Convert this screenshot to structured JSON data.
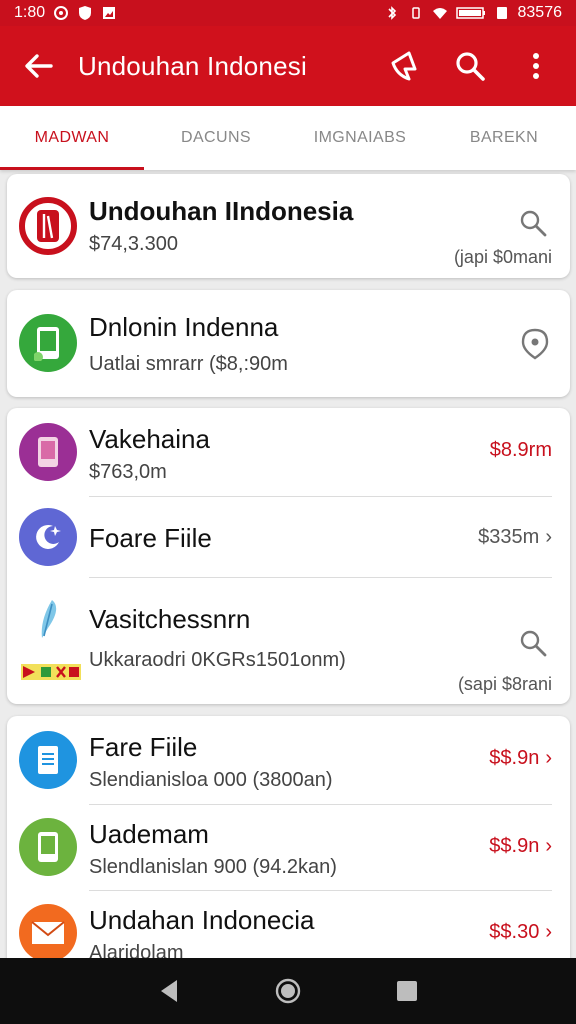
{
  "status_bar": {
    "time": "1:80",
    "battery_text": "83576",
    "color": "#c8101d"
  },
  "app_bar": {
    "title": "Undouhan Indonesi",
    "back_icon": "arrow-left-icon",
    "actions": [
      "pin-icon",
      "search-icon",
      "more-vert-icon"
    ],
    "color": "#d0111c"
  },
  "tabs": [
    {
      "label": "MADWAN",
      "active": true
    },
    {
      "label": "DACUNS",
      "active": false
    },
    {
      "label": "IMGNAIABS",
      "active": false
    },
    {
      "label": "BAREKN",
      "active": false
    }
  ],
  "cards": {
    "c1": {
      "title": "Undouhan IIndonesia",
      "subtitle": "$74,3.300",
      "right_text": "(japi $0mani",
      "icon": "red-app-icon",
      "action_icon": "search-icon"
    },
    "c2": {
      "title": "Dnlonin Indenna",
      "subtitle": "Uatlai smrarr ($8,:90m",
      "icon": "green-phone-app-icon",
      "action_icon": "location-pin-icon"
    },
    "c3": [
      {
        "title": "Vakehaina",
        "subtitle": "$763,0m",
        "right_text": "$8.9rm",
        "icon": "purple-phone-app-icon"
      },
      {
        "title": "Foare Fiile",
        "right_text": "$335m",
        "icon": "blue-moon-app-icon"
      },
      {
        "title": "Vasitchessnrn",
        "subtitle": "Ukkaraodri 0KGRs1501onm)",
        "right_text": "(sapi $8rani",
        "icon": "feather-app-icon",
        "action_icon": "search-icon"
      }
    ],
    "c4": [
      {
        "title": "Fare Fiile",
        "subtitle": "Slendianisloa 000 (3800an)",
        "right_text": "$$.9n",
        "icon": "blue-document-app-icon"
      },
      {
        "title": "Uademam",
        "subtitle": "Slendlanislan 900 (94.2kan)",
        "right_text": "$$.9n",
        "icon": "green-phone-app-icon"
      },
      {
        "title": "Undahan Indonecia",
        "subtitle": "Alaridolam",
        "right_text": "$$.30",
        "icon": "mail-app-icon"
      }
    ]
  },
  "nav_bar": {
    "buttons": [
      "back-triangle-icon",
      "home-circle-icon",
      "recents-square-icon"
    ]
  },
  "colors": {
    "accent": "#c8101d",
    "card_bg": "#ffffff",
    "page_bg": "#ececec"
  }
}
